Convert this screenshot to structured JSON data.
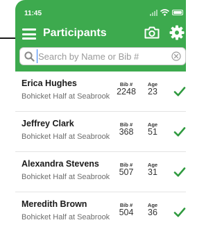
{
  "status": {
    "time": "11:45"
  },
  "header": {
    "title": "Participants",
    "menu_icon": "hamburger-menu-icon",
    "camera_icon": "camera-icon",
    "settings_icon": "gear-icon"
  },
  "search": {
    "placeholder": "Search by Name or Bib #",
    "value": ""
  },
  "columns": {
    "bib": "Bib #",
    "age": "Age"
  },
  "participants": [
    {
      "name": "Erica Hughes",
      "event": "Bohicket Half at Seabrook",
      "bib": "2248",
      "age": "23",
      "checked_in": true
    },
    {
      "name": "Jeffrey Clark",
      "event": "Bohicket Half at Seabrook",
      "bib": "368",
      "age": "51",
      "checked_in": true
    },
    {
      "name": "Alexandra Stevens",
      "event": "Bohicket Half at Seabrook",
      "bib": "507",
      "age": "31",
      "checked_in": true
    },
    {
      "name": "Meredith Brown",
      "event": "Bohicket Half at Seabrook",
      "bib": "504",
      "age": "36",
      "checked_in": true
    }
  ],
  "colors": {
    "header_green": "#3daa4e",
    "check_green": "#2f9a3f"
  }
}
